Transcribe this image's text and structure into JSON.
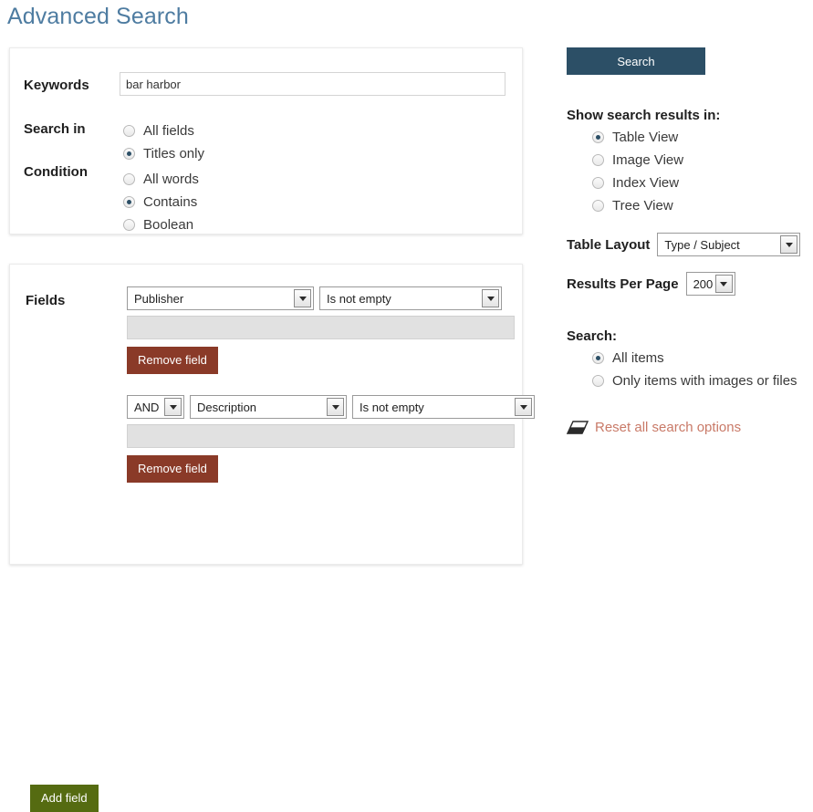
{
  "page": {
    "title": "Advanced Search"
  },
  "keywords": {
    "label": "Keywords",
    "value": "bar harbor",
    "placeholder": ""
  },
  "search_in": {
    "label": "Search in",
    "options": [
      {
        "label": "All fields",
        "selected": false
      },
      {
        "label": "Titles only",
        "selected": true
      }
    ]
  },
  "condition": {
    "label": "Condition",
    "options": [
      {
        "label": "All words",
        "selected": false
      },
      {
        "label": "Contains",
        "selected": true
      },
      {
        "label": "Boolean",
        "selected": false
      }
    ]
  },
  "fields": {
    "label": "Fields",
    "rows": [
      {
        "join": null,
        "field": "Publisher",
        "operator": "Is not empty",
        "value": "",
        "remove_label": "Remove field"
      },
      {
        "join": "AND",
        "field": "Description",
        "operator": "Is not empty",
        "value": "",
        "remove_label": "Remove field"
      }
    ],
    "add_label": "Add field"
  },
  "sidebar": {
    "search_button": "Search",
    "show_results_heading": "Show search results in:",
    "views": [
      {
        "label": "Table View",
        "selected": true
      },
      {
        "label": "Image View",
        "selected": false
      },
      {
        "label": "Index View",
        "selected": false
      },
      {
        "label": "Tree View",
        "selected": false
      }
    ],
    "table_layout_label": "Table Layout",
    "table_layout_value": "Type / Subject",
    "results_per_page_label": "Results Per Page",
    "results_per_page_value": "200",
    "search_scope_heading": "Search:",
    "scope": [
      {
        "label": "All items",
        "selected": true
      },
      {
        "label": "Only items with images or files",
        "selected": false
      }
    ],
    "reset_label": "Reset all search options",
    "reset_icon": "eraser-icon"
  },
  "colors": {
    "title": "#4e7ca1",
    "search_button": "#2c4f66",
    "remove_button": "#8a3a28",
    "add_button": "#556b11",
    "reset_link": "#c97a68"
  }
}
